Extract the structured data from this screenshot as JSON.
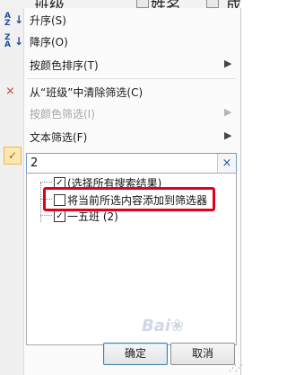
{
  "header": {
    "col1_text": "班级",
    "col2_text": "姓名",
    "col3_text": "成"
  },
  "menu": {
    "sort_asc": "升序(S)",
    "sort_desc": "降序(O)",
    "sort_by_color": "按颜色排序(T)",
    "clear_filter": "从“班级”中清除筛选(C)",
    "filter_by_color": "按颜色筛选(I)",
    "text_filter": "文本筛选(F)"
  },
  "search": {
    "value": "2",
    "clear_symbol": "×"
  },
  "list": {
    "select_all": "(选择所有搜索结果)",
    "add_to_filter": "将当前所选内容添加到筛选器",
    "item1": "一五班 (2)"
  },
  "buttons": {
    "ok": "确定",
    "cancel": "取消"
  },
  "icons": {
    "sort_asc": "sort-ascending-icon",
    "sort_desc": "sort-descending-icon",
    "clear_filter": "clear-filter-icon",
    "check": "checkmark-icon"
  },
  "colors": {
    "highlight_border": "#e3001b",
    "accent": "#1f4e9c"
  }
}
